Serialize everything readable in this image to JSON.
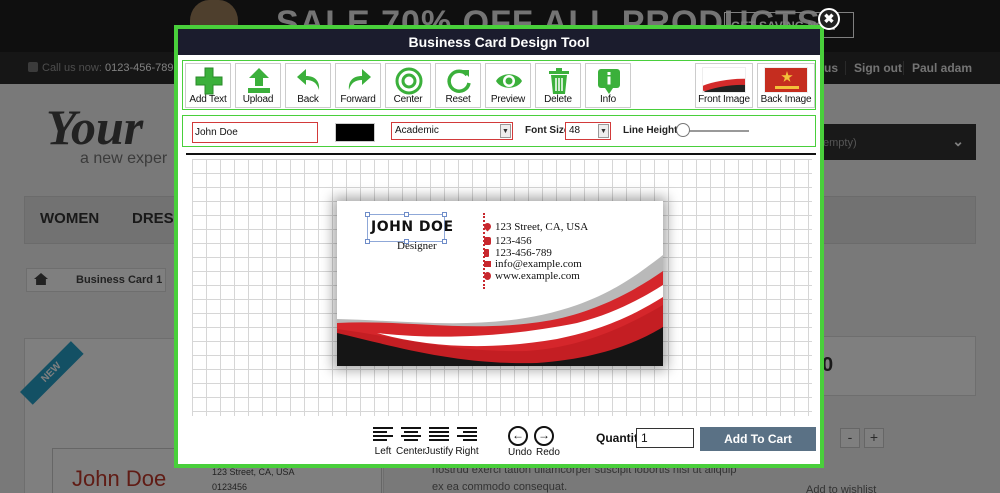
{
  "background": {
    "banner_text": "SALE 70% OFF ALL PRODUCTS",
    "banner_button": "GET SAVING NOW",
    "call_label": "Call us now:",
    "call_number": "0123-456-789",
    "top_links": [
      "us",
      "Sign out",
      "Paul adam"
    ],
    "logo_text": "Your",
    "tagline": "a new exper",
    "cart_label": "t",
    "cart_empty": "(empty)",
    "nav_items": [
      "WOMEN",
      "DRESS"
    ],
    "breadcrumb": "Business Card 1",
    "ribbon": "NEW",
    "preview_name": "John Doe",
    "preview_address": "123 Street, CA, USA",
    "preview_phone": "0123456",
    "lorem_lines": [
      "nostrud exerci tation ullamcorper suscipit lobortis nisl ut aliquip",
      "ex ea commodo consequat."
    ],
    "price_fragment": "0",
    "qty_controls": [
      "-",
      "+"
    ],
    "wishlist": "Add to wishlist"
  },
  "modal": {
    "title": "Business Card Design Tool",
    "close_symbol": "✖",
    "tools": [
      {
        "label": "Add Text",
        "icon": "plus-icon"
      },
      {
        "label": "Upload",
        "icon": "upload-icon"
      },
      {
        "label": "Back",
        "icon": "back-arrow-icon"
      },
      {
        "label": "Forward",
        "icon": "forward-arrow-icon"
      },
      {
        "label": "Center",
        "icon": "center-icon"
      },
      {
        "label": "Reset",
        "icon": "reset-icon"
      },
      {
        "label": "Preview",
        "icon": "eye-icon"
      },
      {
        "label": "Delete",
        "icon": "trash-icon"
      },
      {
        "label": "Info",
        "icon": "info-icon"
      }
    ],
    "front_image_label": "Front Image",
    "back_image_label": "Back Image",
    "text_value": "John Doe",
    "text_color": "#000000",
    "font_family": "Academic",
    "font_size_label": "Font Size:",
    "font_size": "48",
    "line_height_label": "Line Height:",
    "line_height_level": 0.05,
    "card": {
      "name": "JOHN DOE",
      "role": "Designer",
      "address": "123 Street, CA, USA",
      "phone": "123-456",
      "mobile": "123-456-789",
      "email": "info@example.com",
      "website": "www.example.com"
    },
    "align_buttons": [
      "Left",
      "Center",
      "Justify",
      "Right"
    ],
    "undo_label": "Undo",
    "redo_label": "Redo",
    "quantity_label": "Quantity",
    "quantity_value": "1",
    "add_to_cart": "Add To Cart"
  },
  "colors": {
    "modal_border": "#49cf3b",
    "title_bar": "#1b1c2d",
    "accent_red": "#c8282e",
    "cart_button": "#5a7185"
  }
}
